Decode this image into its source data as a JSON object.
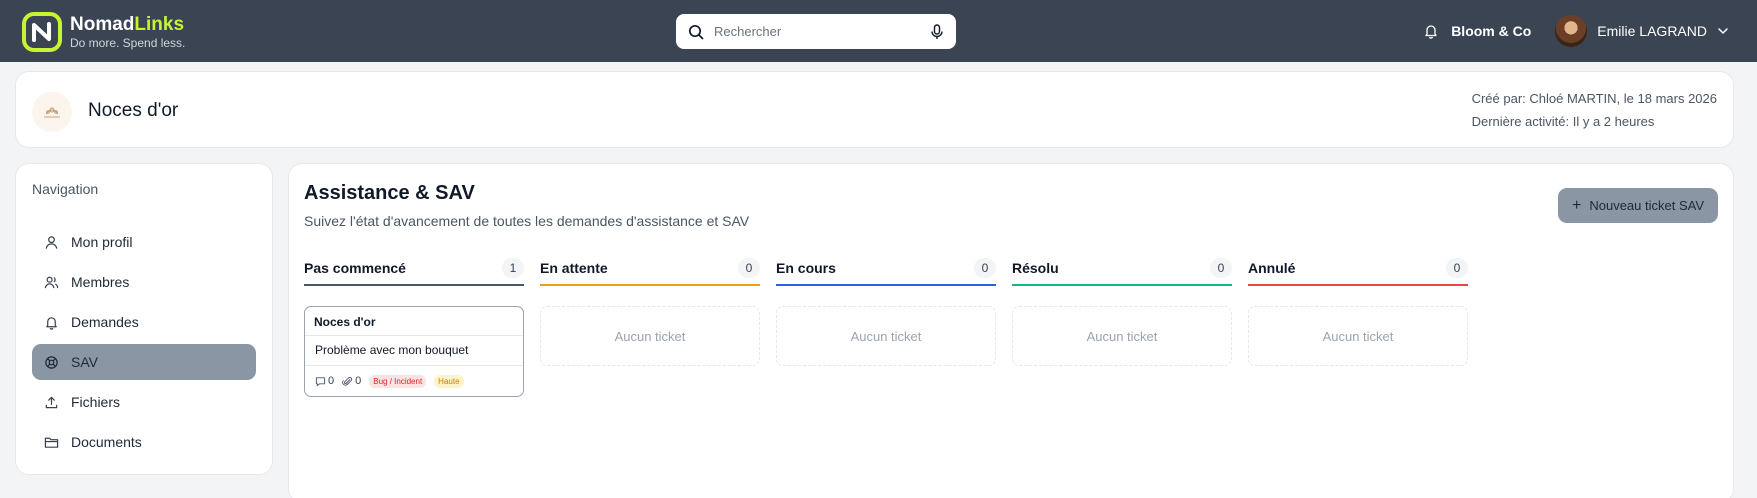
{
  "app": {
    "brand_a": "Nomad",
    "brand_b": "Links",
    "tagline": "Do more. Spend less.",
    "accent": "#c6f432"
  },
  "search": {
    "placeholder": "Rechercher",
    "icon": "search-icon",
    "mic_icon": "microphone-icon"
  },
  "topbar": {
    "company": "Bloom & Co",
    "user_name": "Emilie LAGRAND",
    "bell_icon": "bell-icon"
  },
  "header": {
    "org_name": "Noces d'or",
    "created_by": "Créé par: Chloé MARTIN, le 18 mars 2026",
    "last_activity": "Dernière activité: Il y a 2 heures"
  },
  "sidebar": {
    "title": "Navigation",
    "items": [
      {
        "label": "Mon profil",
        "icon": "user-icon"
      },
      {
        "label": "Membres",
        "icon": "users-icon"
      },
      {
        "label": "Demandes",
        "icon": "bell-icon"
      },
      {
        "label": "SAV",
        "icon": "lifebuoy-icon",
        "active": true
      },
      {
        "label": "Fichiers",
        "icon": "upload-icon"
      },
      {
        "label": "Documents",
        "icon": "folder-icon"
      }
    ]
  },
  "main": {
    "title": "Assistance & SAV",
    "subtitle": "Suivez l'état d'avancement de toutes les demandes d'assistance et SAV",
    "new_button": "Nouveau ticket SAV",
    "columns": [
      {
        "name": "Pas commencé",
        "count": "1",
        "color": "#4b5563"
      },
      {
        "name": "En attente",
        "count": "0",
        "color": "#f59e0b"
      },
      {
        "name": "En cours",
        "count": "0",
        "color": "#2563eb"
      },
      {
        "name": "Résolu",
        "count": "0",
        "color": "#10b981"
      },
      {
        "name": "Annulé",
        "count": "0",
        "color": "#ef4444"
      }
    ],
    "empty_text": "Aucun ticket",
    "ticket": {
      "title": "Noces d'or",
      "description": "Problème avec mon bouquet",
      "comments": "0",
      "attachments": "0",
      "category": "Bug / Incident",
      "priority": "Haute"
    }
  }
}
